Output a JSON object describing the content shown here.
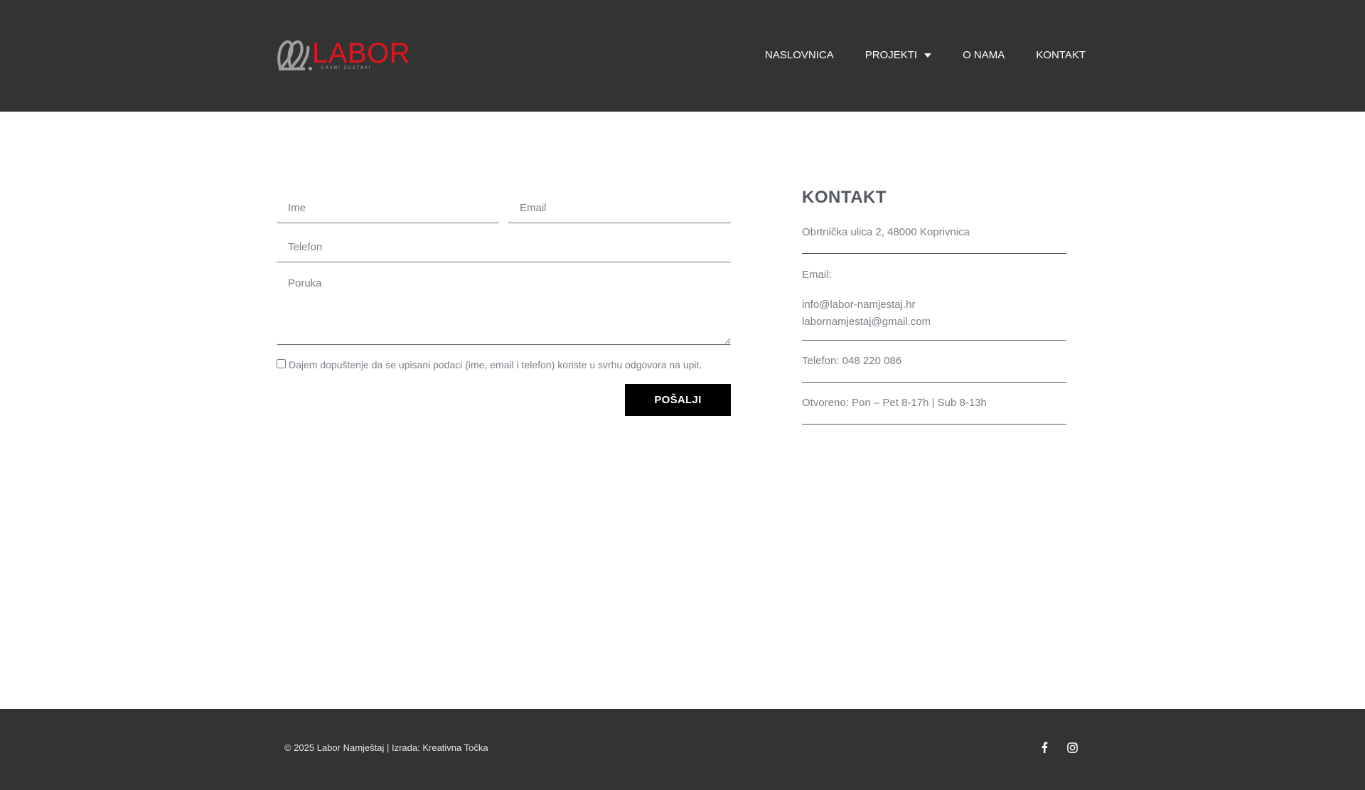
{
  "header": {
    "logo": {
      "word": "LABOR",
      "subtitle": "DRVNI SUSTAVI"
    },
    "nav": [
      {
        "label": "NASLOVNICA"
      },
      {
        "label": "PROJEKTI",
        "has_dropdown": true
      },
      {
        "label": "O NAMA"
      },
      {
        "label": "KONTAKT"
      }
    ]
  },
  "form": {
    "name_placeholder": "Ime",
    "email_placeholder": "Email",
    "phone_placeholder": "Telefon",
    "message_placeholder": "Poruka",
    "consent_label": "Dajem dopuštenje da se upisani podaci (ime, email i telefon) koriste u svrhu odgovora na upit.",
    "submit_label": "POŠALJI"
  },
  "contact": {
    "title": "KONTAKT",
    "address": "Obrtnička ulica 2, 48000 Koprivnica",
    "email_label": "Email:",
    "emails": [
      "info@labor-namjestaj.hr",
      "labornamjestaj@gmail.com"
    ],
    "phone": "Telefon: 048 220 086",
    "hours": "Otvoreno: Pon – Pet 8-17h | Sub 8-13h"
  },
  "footer": {
    "copyright": "© 2025 Labor Namještaj | Izrada: Kreativna Točka",
    "social": [
      {
        "icon": "facebook-icon"
      },
      {
        "icon": "instagram-icon"
      }
    ]
  },
  "colors": {
    "header_bg": "#333333",
    "brand_red": "#e0161d",
    "button_bg": "#000000",
    "text": "#54595f"
  }
}
